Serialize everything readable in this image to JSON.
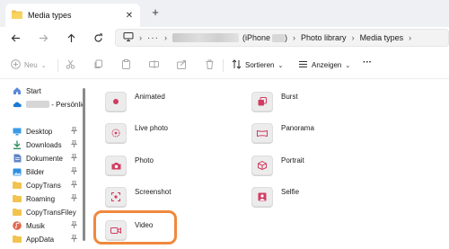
{
  "window": {
    "tab_title": "Media types",
    "new_tab_glyph": "+",
    "close_glyph": "✕"
  },
  "address": {
    "more_glyph": "···",
    "device_label": "(iPhone",
    "crumbs": [
      "Photo library",
      "Media types"
    ],
    "chevron": "›"
  },
  "commands": {
    "new_label": "Neu",
    "sort_label": "Sortieren",
    "view_label": "Anzeigen",
    "more_glyph": "···",
    "dropdown_glyph": "⌄"
  },
  "sidebar": {
    "items": [
      {
        "label": "Start",
        "icon": "home-icon"
      },
      {
        "label": "- Persönlich",
        "icon": "onedrive-cloud-icon"
      },
      {
        "label": "Desktop",
        "icon": "desktop-icon"
      },
      {
        "label": "Downloads",
        "icon": "download-icon"
      },
      {
        "label": "Dokumente",
        "icon": "document-icon"
      },
      {
        "label": "Bilder",
        "icon": "pictures-icon"
      },
      {
        "label": "CopyTrans",
        "icon": "folder-icon"
      },
      {
        "label": "Roaming",
        "icon": "folder-icon"
      },
      {
        "label": "CopyTransFiley",
        "icon": "folder-icon"
      },
      {
        "label": "Musik",
        "icon": "music-icon"
      },
      {
        "label": "AppData",
        "icon": "folder-icon"
      }
    ],
    "pin_glyph": "📌"
  },
  "folders": [
    {
      "label": "Animated",
      "icon": "animated-icon"
    },
    {
      "label": "Burst",
      "icon": "burst-icon"
    },
    {
      "label": "Live photo",
      "icon": "live-photo-icon"
    },
    {
      "label": "Panorama",
      "icon": "panorama-icon"
    },
    {
      "label": "Photo",
      "icon": "camera-icon"
    },
    {
      "label": "Portrait",
      "icon": "portrait-cube-icon"
    },
    {
      "label": "Screenshot",
      "icon": "screenshot-icon"
    },
    {
      "label": "Selfie",
      "icon": "selfie-icon"
    },
    {
      "label": "Video",
      "icon": "video-icon"
    }
  ],
  "colors": {
    "accent_icon": "#d23c61",
    "highlight": "#f0883e",
    "folder_thumb": "#ececec"
  }
}
